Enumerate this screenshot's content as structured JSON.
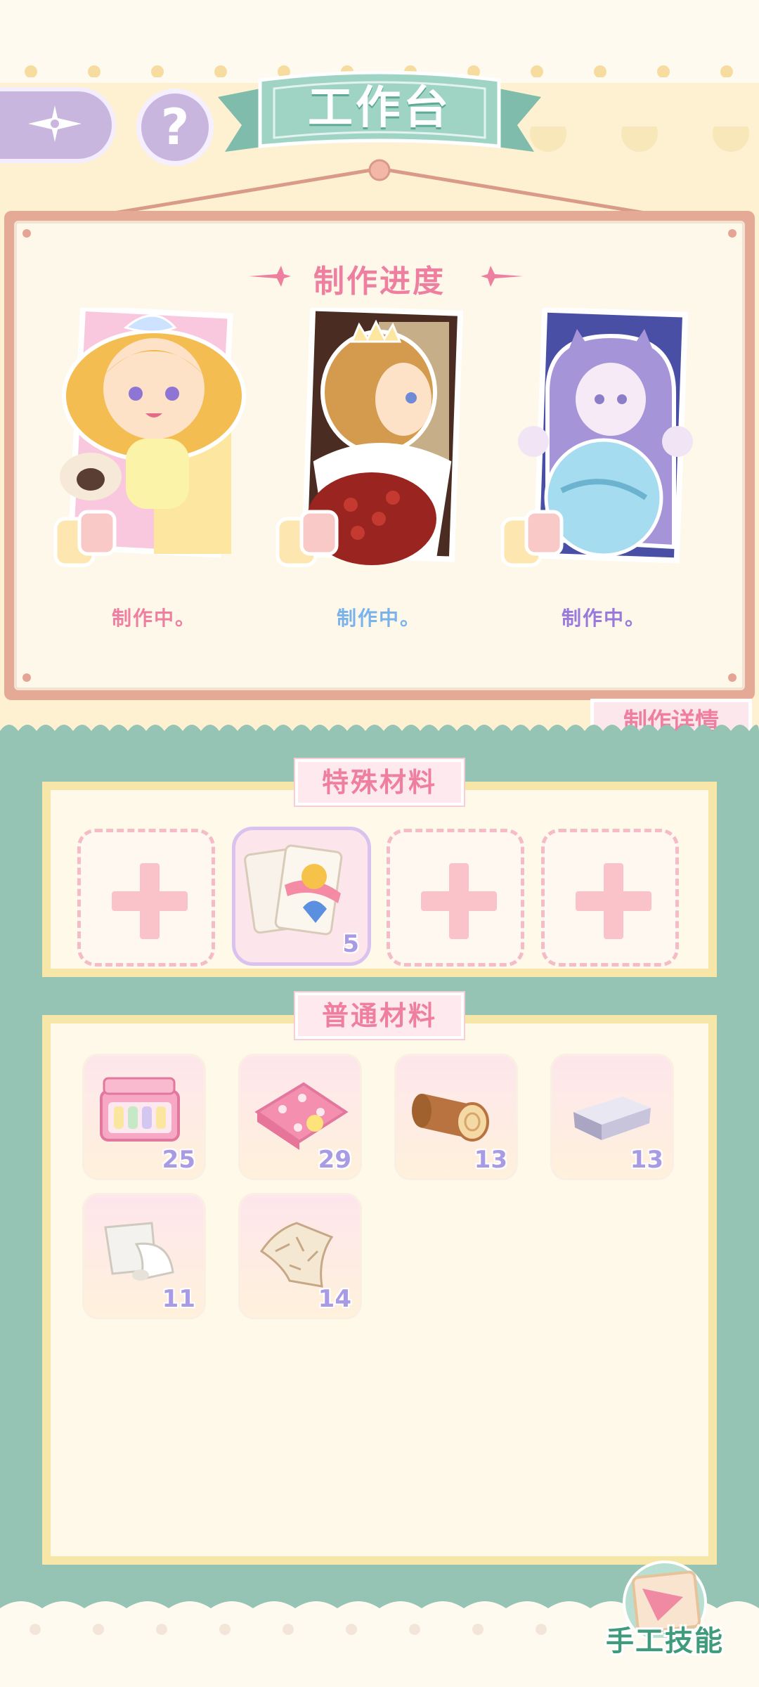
{
  "header": {
    "title": "工作台",
    "back_icon": "compass-star-icon",
    "help_label": "?"
  },
  "progress": {
    "title": "制作进度",
    "slots": [
      {
        "status": "制作中。",
        "status_color": "#ee7fa0"
      },
      {
        "status": "制作中。",
        "status_color": "#7ab2ec"
      },
      {
        "status": "制作中。",
        "status_color": "#9a79dc"
      }
    ],
    "detail_button": "制作详情"
  },
  "special_materials": {
    "label": "特殊材料",
    "slots": [
      {
        "type": "empty"
      },
      {
        "type": "item",
        "name": "playing-cards",
        "count": "5"
      },
      {
        "type": "empty"
      },
      {
        "type": "empty"
      }
    ]
  },
  "common_materials": {
    "label": "普通材料",
    "items": [
      {
        "name": "sewing-box",
        "count": "25"
      },
      {
        "name": "polka-dot-fabric",
        "count": "29"
      },
      {
        "name": "wood-log",
        "count": "13"
      },
      {
        "name": "silver-ingot",
        "count": "13"
      },
      {
        "name": "white-cloth",
        "count": "11"
      },
      {
        "name": "fur-pelt",
        "count": "14"
      }
    ]
  },
  "craft_skill": {
    "label": "手工技能"
  },
  "colors": {
    "teal": "#95c3b4",
    "pink": "#ef7fa0",
    "cream": "#fdf1d2",
    "frame": "#e5aa96",
    "count_purple": "#a89be4"
  }
}
